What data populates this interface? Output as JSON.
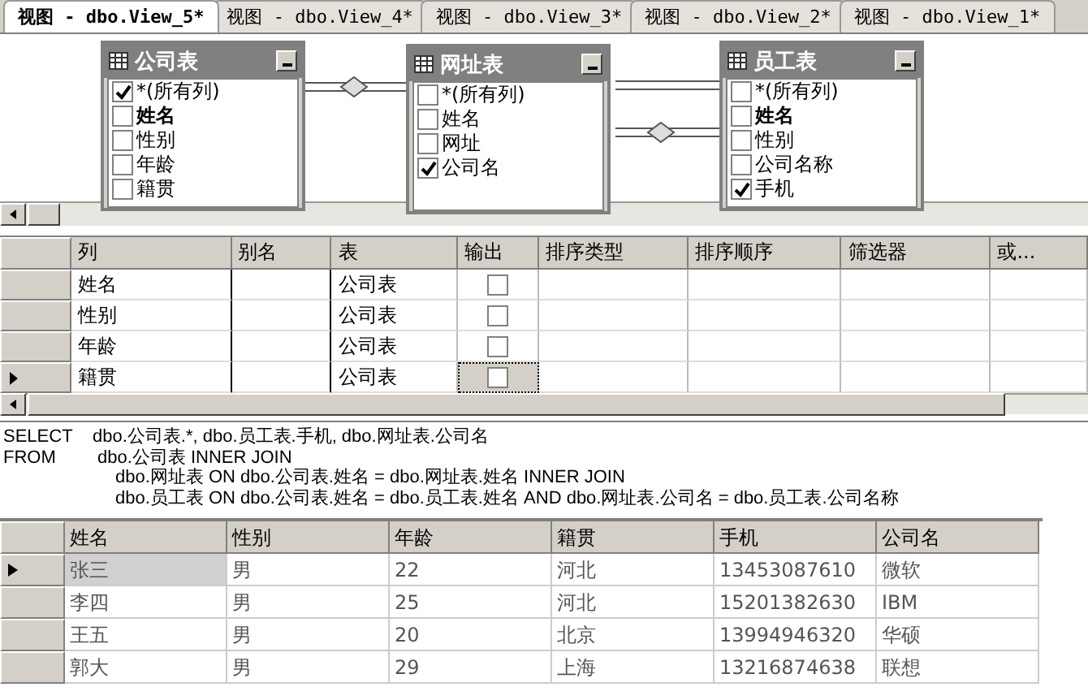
{
  "tabs": [
    {
      "label": "视图 - dbo.View_5*",
      "selected": true
    },
    {
      "label": "视图 - dbo.View_4*",
      "selected": false
    },
    {
      "label": "视图 - dbo.View_3*",
      "selected": false
    },
    {
      "label": "视图 - dbo.View_2*",
      "selected": false
    },
    {
      "label": "视图 - dbo.View_1*",
      "selected": false
    }
  ],
  "diagram": {
    "tables": [
      {
        "title": "公司表",
        "columns": [
          {
            "name": "*(所有列)",
            "checked": true,
            "primary_key": false
          },
          {
            "name": "姓名",
            "checked": false,
            "primary_key": true
          },
          {
            "name": "性别",
            "checked": false,
            "primary_key": false
          },
          {
            "name": "年龄",
            "checked": false,
            "primary_key": false
          },
          {
            "name": "籍贯",
            "checked": false,
            "primary_key": false
          }
        ]
      },
      {
        "title": "网址表",
        "columns": [
          {
            "name": "*(所有列)",
            "checked": false,
            "primary_key": false
          },
          {
            "name": "姓名",
            "checked": false,
            "primary_key": false
          },
          {
            "name": "网址",
            "checked": false,
            "primary_key": false
          },
          {
            "name": "公司名",
            "checked": true,
            "primary_key": false
          }
        ]
      },
      {
        "title": "员工表",
        "columns": [
          {
            "name": "*(所有列)",
            "checked": false,
            "primary_key": false
          },
          {
            "name": "姓名",
            "checked": false,
            "primary_key": true
          },
          {
            "name": "性别",
            "checked": false,
            "primary_key": false
          },
          {
            "name": "公司名称",
            "checked": false,
            "primary_key": false
          },
          {
            "name": "手机",
            "checked": true,
            "primary_key": false
          }
        ]
      }
    ]
  },
  "criteria": {
    "columns": [
      "列",
      "别名",
      "表",
      "输出",
      "排序类型",
      "排序顺序",
      "筛选器",
      "或..."
    ],
    "rows": [
      {
        "column": "姓名",
        "table": "公司表",
        "output": false,
        "selected": false
      },
      {
        "column": "性别",
        "table": "公司表",
        "output": false,
        "selected": false
      },
      {
        "column": "年龄",
        "table": "公司表",
        "output": false,
        "selected": false
      },
      {
        "column": "籍贯",
        "table": "公司表",
        "output": false,
        "selected": true
      }
    ]
  },
  "sql": [
    {
      "keyword": "SELECT",
      "text": "dbo.公司表.*, dbo.员工表.手机, dbo.网址表.公司名"
    },
    {
      "keyword": "FROM",
      "text": "dbo.公司表 INNER JOIN"
    },
    {
      "text": "dbo.网址表 ON dbo.公司表.姓名 = dbo.网址表.姓名 INNER JOIN"
    },
    {
      "text": "dbo.员工表 ON dbo.公司表.姓名 = dbo.员工表.姓名 AND dbo.网址表.公司名 = dbo.员工表.公司名称"
    }
  ],
  "results": {
    "columns": [
      "姓名",
      "性别",
      "年龄",
      "籍贯",
      "手机",
      "公司名"
    ],
    "rows": [
      {
        "cells": [
          "张三",
          "男",
          "22",
          "河北",
          "13453087610",
          "微软"
        ],
        "selected": true
      },
      {
        "cells": [
          "李四",
          "男",
          "25",
          "河北",
          "15201382630",
          "IBM"
        ],
        "selected": false
      },
      {
        "cells": [
          "王五",
          "男",
          "20",
          "北京",
          "13994946320",
          "华硕"
        ],
        "selected": false
      },
      {
        "cells": [
          "郭大",
          "男",
          "29",
          "上海",
          "13216874638",
          "联想"
        ],
        "selected": false
      }
    ]
  }
}
